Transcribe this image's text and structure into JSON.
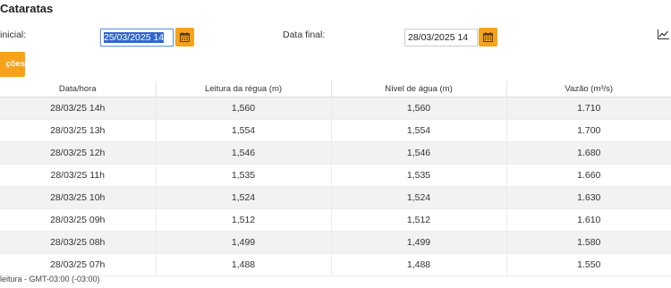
{
  "page": {
    "title": "Cataratas"
  },
  "filters": {
    "start_label": "inicial:",
    "start_value": "25/03/2025 14",
    "end_label": "Data final:",
    "end_value": "28/03/2025 14",
    "action_label": "ções"
  },
  "table": {
    "headers": [
      "Data/hora",
      "Leitura da régua (m)",
      "Nível de água (m)",
      "Vazão (m³/s)"
    ],
    "rows": [
      [
        "28/03/25 14h",
        "1,560",
        "1,560",
        "1.710"
      ],
      [
        "28/03/25 13h",
        "1,554",
        "1,554",
        "1.700"
      ],
      [
        "28/03/25 12h",
        "1,546",
        "1,546",
        "1.680"
      ],
      [
        "28/03/25 11h",
        "1,535",
        "1,535",
        "1.660"
      ],
      [
        "28/03/25 10h",
        "1,524",
        "1,524",
        "1.630"
      ],
      [
        "28/03/25 09h",
        "1,512",
        "1,512",
        "1.610"
      ],
      [
        "28/03/25 08h",
        "1,499",
        "1,499",
        "1.580"
      ],
      [
        "28/03/25 07h",
        "1,488",
        "1,488",
        "1.550"
      ]
    ]
  },
  "footnote": "leitura - GMT-03:00 (-03:00)",
  "colors": {
    "accent": "#f7a21b",
    "selection": "#3366cc",
    "row_alt": "#f2f2f2"
  },
  "icons": {
    "calendar": "calendar-icon",
    "chart": "line-chart-icon"
  }
}
